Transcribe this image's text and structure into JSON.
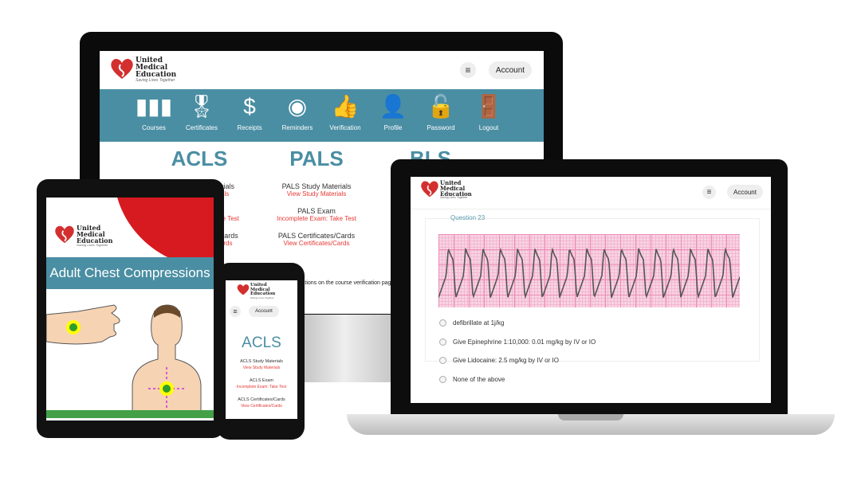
{
  "brand": {
    "name_line1": "United",
    "name_line2": "Medical",
    "name_line3": "Education",
    "tagline": "Saving Lives Together",
    "heart_color": "#d32f2f",
    "accent": "#4a8ea3",
    "link_color": "#e53935"
  },
  "header": {
    "account_label": "Account",
    "menu_icon": "hamburger-icon"
  },
  "nav": [
    {
      "label": "Courses",
      "icon": "books-icon"
    },
    {
      "label": "Certificates",
      "icon": "certificate-icon"
    },
    {
      "label": "Receipts",
      "icon": "dollar-cycle-icon"
    },
    {
      "label": "Reminders",
      "icon": "bell-icon"
    },
    {
      "label": "Verification",
      "icon": "thumbs-up-icon"
    },
    {
      "label": "Profile",
      "icon": "doctor-icon"
    },
    {
      "label": "Password",
      "icon": "padlock-icon"
    },
    {
      "label": "Logout",
      "icon": "door-exit-icon"
    }
  ],
  "courses": [
    {
      "title": "ACLS",
      "study": "ACLS Study Materials",
      "study_link": "View Study Materials",
      "exam": "ACLS Exam",
      "exam_link": "Incomplete Exam: Take Test",
      "certs": "ACLS Certificates/Cards",
      "certs_link": "View Certificates/Cards"
    },
    {
      "title": "PALS",
      "study": "PALS Study Materials",
      "study_link": "View Study Materials",
      "exam": "PALS Exam",
      "exam_link": "Incomplete Exam: Take Test",
      "certs": "PALS Certificates/Cards",
      "certs_link": "View Certificates/Cards"
    },
    {
      "title": "BLS"
    }
  ],
  "monitor_note": "cations on the course verification page.",
  "tablet": {
    "banner": "Adult Chest Compressions"
  },
  "quiz": {
    "question": "Question 23",
    "options": [
      "defibrillate at 1j/kg",
      "Give Epinephrine 1:10,000: 0.01 mg/kg by IV or IO",
      "Give Lidocaine: 2.5 mg/kg by IV or IO",
      "None of the above"
    ]
  }
}
